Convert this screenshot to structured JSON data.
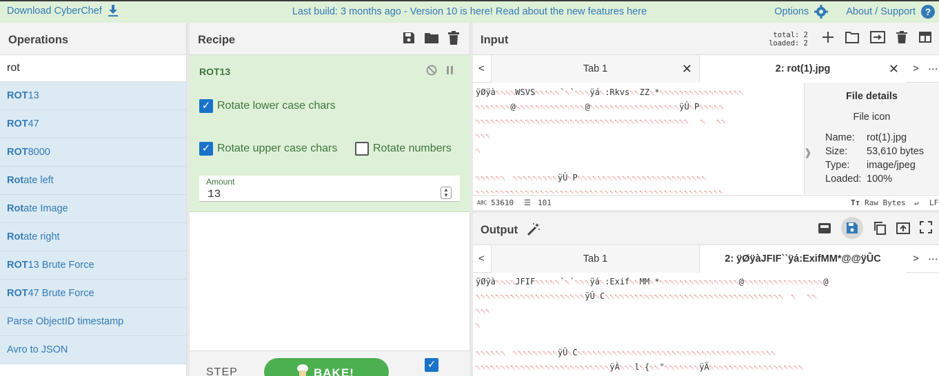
{
  "banner": {
    "download_label": "Download CyberChef",
    "build_text": "Last build: 3 months ago - Version 10 is here! Read about the new features here",
    "options_label": "Options",
    "about_label": "About / Support"
  },
  "operations": {
    "title": "Operations",
    "search_value": "rot",
    "items": [
      {
        "bold": "ROT",
        "rest": "13"
      },
      {
        "bold": "ROT",
        "rest": "47"
      },
      {
        "bold": "ROT",
        "rest": "8000"
      },
      {
        "bold": "Rot",
        "rest": "ate left"
      },
      {
        "bold": "Rot",
        "rest": "ate Image"
      },
      {
        "bold": "Rot",
        "rest": "ate right"
      },
      {
        "bold": "ROT",
        "rest": "13 Brute Force"
      },
      {
        "bold": "ROT",
        "rest": "47 Brute Force"
      }
    ],
    "item9": "Parse ObjectID timestamp",
    "item10": "Avro to JSON"
  },
  "recipe": {
    "title": "Recipe",
    "op_name": "ROT13",
    "rotate_lower": "Rotate lower case chars",
    "rotate_upper": "Rotate upper case chars",
    "rotate_numbers": "Rotate numbers",
    "amount_label": "Amount",
    "amount_value": "13",
    "step_label": "STEP",
    "bake_label": "BAKE!"
  },
  "input": {
    "title": "Input",
    "total": "total:  2",
    "loaded": "loaded:  2",
    "tab1": "Tab 1",
    "tab2": "2: rot(1).jpg",
    "details_title": "File details",
    "file_icon": "File icon",
    "name_k": "Name:",
    "name_v": "rot(1).jpg",
    "size_k": "Size:",
    "size_v": "53,610 bytes",
    "type_k": "Type:",
    "type_v": "image/jpeg",
    "loaded_k": "Loaded:",
    "loaded_v": "100%",
    "chars": "53610",
    "lines": "101",
    "encoding": "Raw Bytes",
    "eol": "LF"
  },
  "output": {
    "title": "Output",
    "tab1": "Tab 1",
    "tab2": "2: ÿØÿàJFIF``ÿá:ExifMM*@@ÿÛC"
  }
}
